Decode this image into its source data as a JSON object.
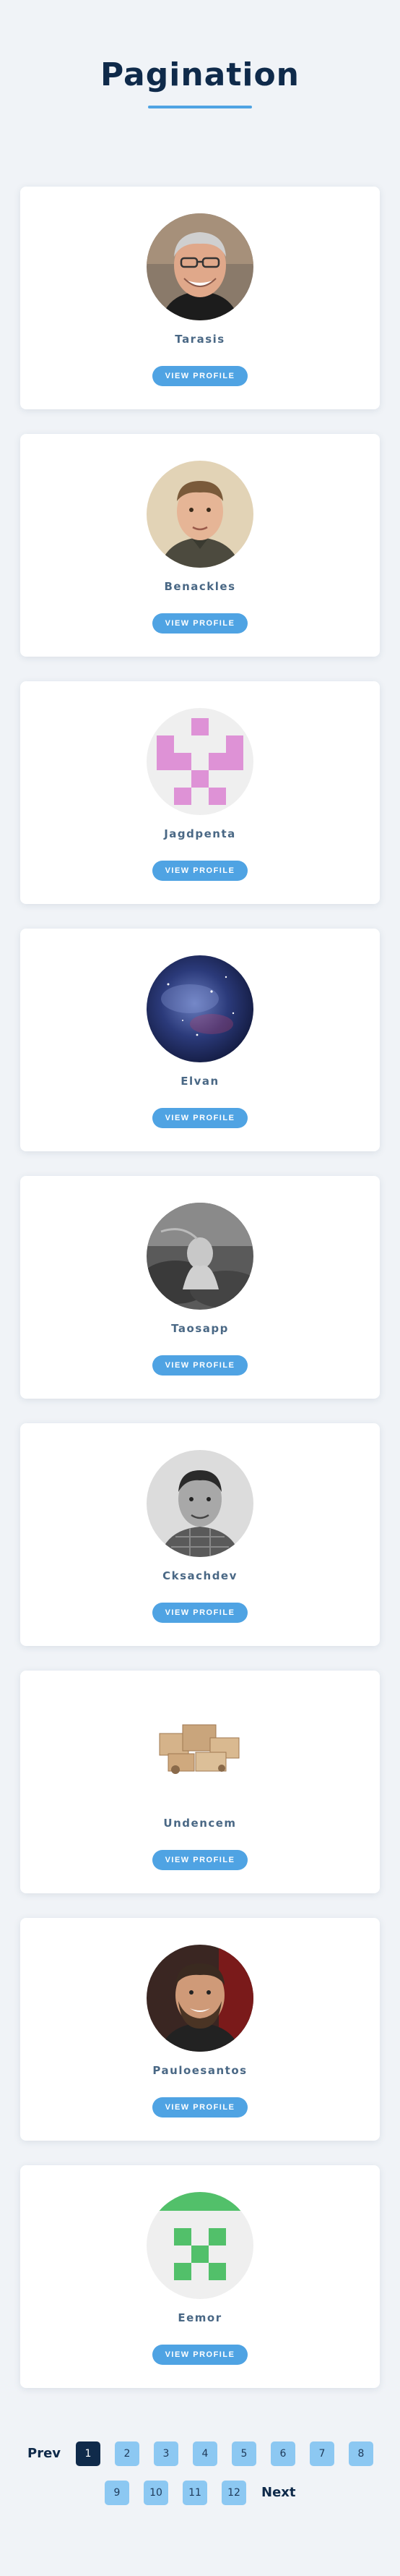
{
  "header": {
    "title": "Pagination"
  },
  "view_label": "VIEW PROFILE",
  "profiles": [
    {
      "name": "Tarasis",
      "avatar": "avatar-photo-older-man"
    },
    {
      "name": "Benackles",
      "avatar": "avatar-photo-man"
    },
    {
      "name": "Jagdpenta",
      "avatar": "identicon-pink"
    },
    {
      "name": "Elvan",
      "avatar": "avatar-nebula"
    },
    {
      "name": "Taosapp",
      "avatar": "avatar-bw-photo"
    },
    {
      "name": "Cksachdev",
      "avatar": "avatar-bw-portrait"
    },
    {
      "name": "Undencem",
      "avatar": "avatar-boxes"
    },
    {
      "name": "Pauloesantos",
      "avatar": "avatar-photo-bearded-man"
    },
    {
      "name": "Eemor",
      "avatar": "identicon-green"
    }
  ],
  "pagination": {
    "prev": "Prev",
    "next": "Next",
    "pages": [
      "1",
      "2",
      "3",
      "4",
      "5",
      "6",
      "7",
      "8",
      "9",
      "10",
      "11",
      "12"
    ],
    "current": "1"
  },
  "colors": {
    "accent": "#4fa3e3",
    "title": "#0f2a4a",
    "page_button": "#8cc8f2",
    "page_active": "#0f2a4a",
    "background": "#f0f3f7"
  }
}
